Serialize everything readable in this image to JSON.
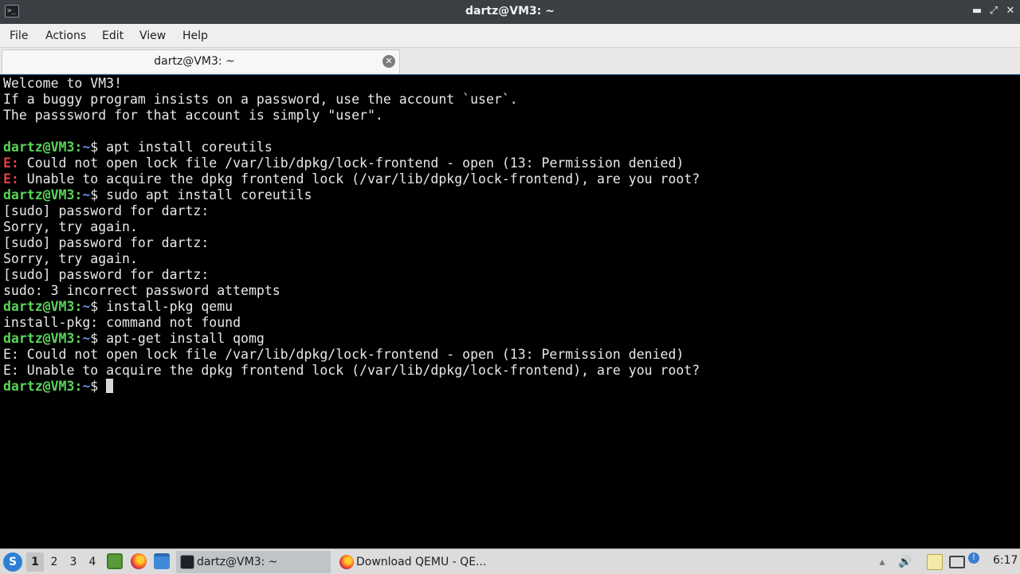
{
  "window": {
    "title": "dartz@VM3: ~",
    "app_icon": ">_",
    "controls": {
      "minimize": "▬",
      "restore": "⤢",
      "close": "✕"
    }
  },
  "menu": {
    "items": [
      "File",
      "Actions",
      "Edit",
      "View",
      "Help"
    ]
  },
  "tabs": [
    {
      "label": "dartz@VM3: ~",
      "close_icon": "✕"
    }
  ],
  "terminal": {
    "prompt_user": "dartz@VM3",
    "prompt_sep": ":",
    "prompt_path": "~",
    "prompt_symbol": "$ ",
    "error_prefix": "E:",
    "lines": [
      {
        "kind": "text",
        "text": "Welcome to VM3!"
      },
      {
        "kind": "text",
        "text": "If a buggy program insists on a password, use the account `user`."
      },
      {
        "kind": "text",
        "text": "The passsword for that account is simply \"user\"."
      },
      {
        "kind": "text",
        "text": ""
      },
      {
        "kind": "prompt",
        "cmd": "apt install coreutils"
      },
      {
        "kind": "error",
        "text": " Could not open lock file /var/lib/dpkg/lock-frontend - open (13: Permission denied)"
      },
      {
        "kind": "error",
        "text": " Unable to acquire the dpkg frontend lock (/var/lib/dpkg/lock-frontend), are you root?"
      },
      {
        "kind": "prompt",
        "cmd": "sudo apt install coreutils"
      },
      {
        "kind": "text",
        "text": "[sudo] password for dartz:"
      },
      {
        "kind": "text",
        "text": "Sorry, try again."
      },
      {
        "kind": "text",
        "text": "[sudo] password for dartz:"
      },
      {
        "kind": "text",
        "text": "Sorry, try again."
      },
      {
        "kind": "text",
        "text": "[sudo] password for dartz:"
      },
      {
        "kind": "text",
        "text": "sudo: 3 incorrect password attempts"
      },
      {
        "kind": "prompt",
        "cmd": "install-pkg qemu"
      },
      {
        "kind": "text",
        "text": "install-pkg: command not found"
      },
      {
        "kind": "prompt",
        "cmd": "apt-get install qomg"
      },
      {
        "kind": "text",
        "text": "E: Could not open lock file /var/lib/dpkg/lock-frontend - open (13: Permission denied)"
      },
      {
        "kind": "text",
        "text": "E: Unable to acquire the dpkg frontend lock (/var/lib/dpkg/lock-frontend), are you root?"
      },
      {
        "kind": "prompt",
        "cmd": "",
        "cursor": true
      }
    ]
  },
  "taskbar": {
    "start_icon": "S",
    "workspaces": [
      "1",
      "2",
      "3",
      "4"
    ],
    "active_workspace": "1",
    "tasks": [
      {
        "label": "dartz@VM3: ~",
        "icon": "terminal-icon",
        "active": true
      },
      {
        "label": "Download QEMU - QE...",
        "icon": "firefox-icon",
        "active": false
      }
    ],
    "clock": "6:17"
  },
  "colors": {
    "terminal_bg": "#000000",
    "prompt_user": "#5ad45a",
    "prompt_path": "#5a8ee8",
    "error": "#e0424a"
  }
}
